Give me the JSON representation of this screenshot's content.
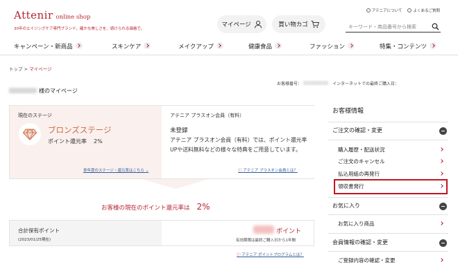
{
  "header": {
    "brand": "Attenir",
    "brand_sub": "online shop",
    "tagline": "30年のエイジングケア専門ブランド。確かな美しさを、続けられる価格で。",
    "mypage_label": "マイページ",
    "cart_label": "買い物カゴ",
    "about_link": "アテニアについて",
    "faq_link": "よくあるご質問",
    "search_placeholder": "キーワード・商品番号から検索"
  },
  "nav": [
    "キャンペーン・新商品",
    "スキンケア",
    "メイクアップ",
    "健康食品",
    "ファッション",
    "特集・コンテンツ"
  ],
  "breadcrumb": {
    "home": "トップ",
    "sep": ">",
    "current": "マイページ"
  },
  "member": {
    "number_label": "お客様番号：",
    "last_purchase_label": "インターネットでの最終ご購入日："
  },
  "page_title_suffix": "様のマイページ",
  "stage": {
    "label": "現在のステージ",
    "name": "ブロンズステージ",
    "rate_label": "ポイント還元率",
    "rate_value": "2%",
    "next_link": "来年度のステージ・還元率はこちら"
  },
  "plus": {
    "label": "アテニア プラスオン会員（有料）",
    "status": "未登録",
    "desc": "アテニア プラスオン会員（有料）では、ポイント還元率UPや送料無料などの様々な特典をご用意しています。",
    "link": "アテニア プラスオン会員とは？"
  },
  "rate_notice": {
    "text": "お客様の現在のポイント還元率は",
    "value": "2%"
  },
  "points": {
    "label": "合計保有ポイント",
    "date": "(2023/01/25現在)",
    "unit": "ポイント",
    "note": "有効期限は最終ご購入日から1年間",
    "link": "アテニア ポイントプログラムとは？"
  },
  "sidebar": {
    "title": "お客様情報",
    "sections": [
      {
        "head": "ご注文の確認・変更",
        "items": [
          "購入履歴・配送状況",
          "ご注文のキャンセル",
          "払込用紙の再発行",
          "領収書発行"
        ]
      },
      {
        "head": "お気に入り",
        "items": [
          "お気に入り商品"
        ]
      },
      {
        "head": "会員情報の確認・変更",
        "items": [
          "ご登録内容の確認・変更"
        ]
      }
    ]
  },
  "colors": {
    "brand": "#b5232f",
    "stage": "#c96a3e",
    "link": "#2d5a9e",
    "highlight": "#c0161f"
  }
}
